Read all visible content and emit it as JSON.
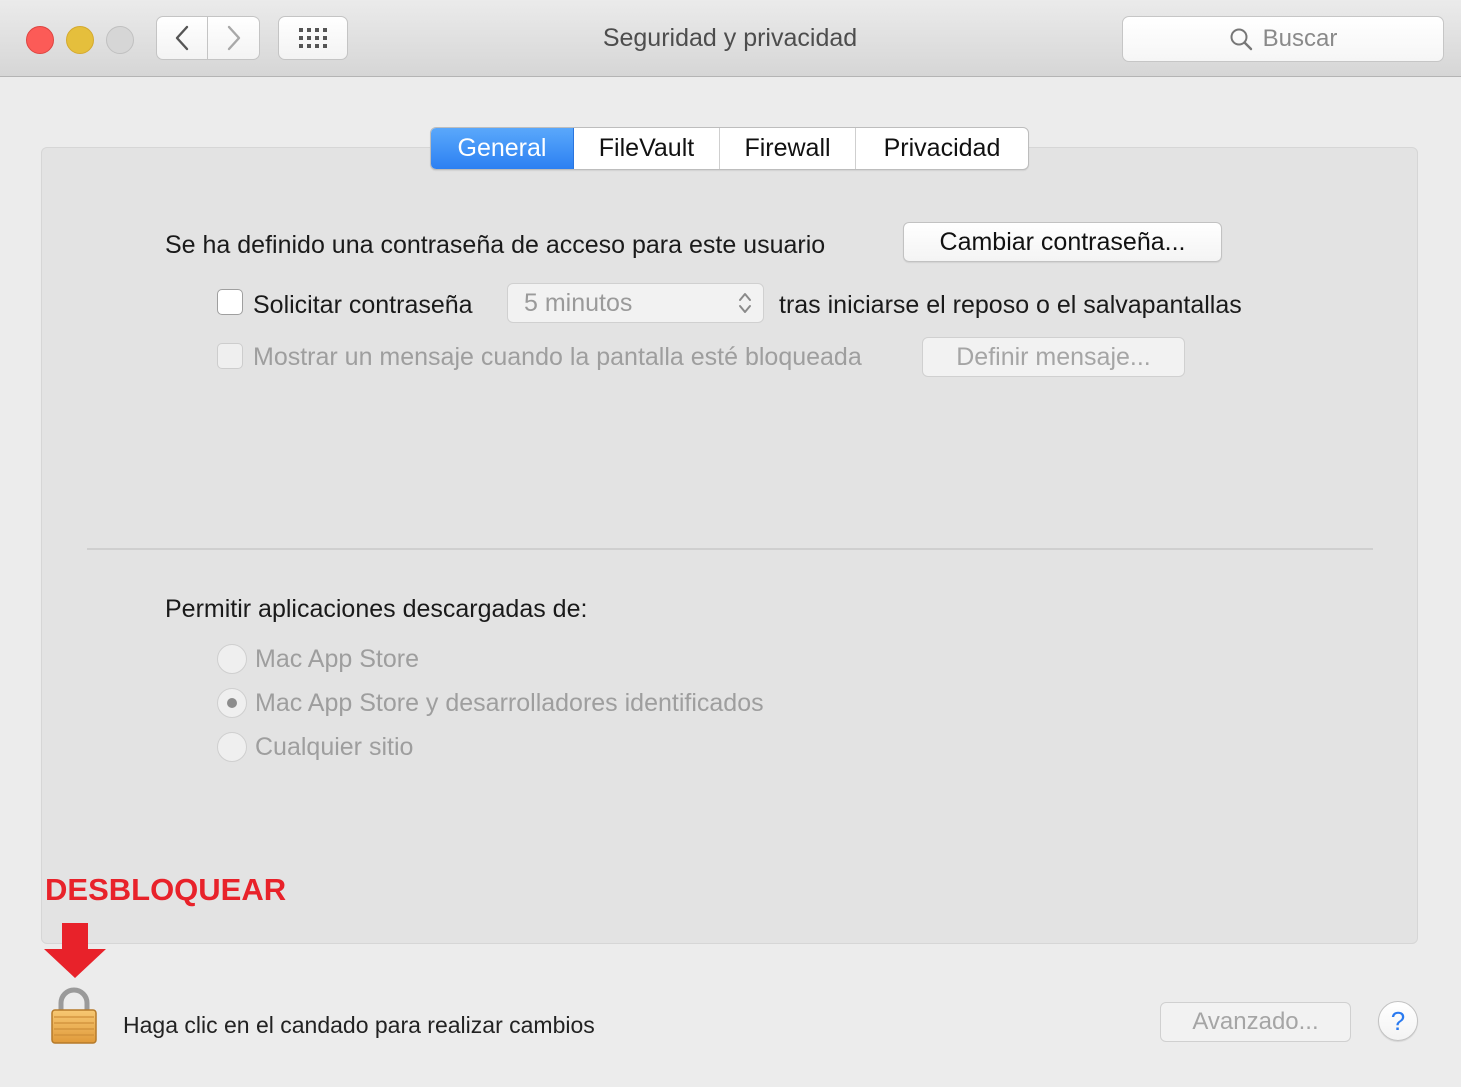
{
  "window": {
    "title": "Seguridad y privacidad",
    "search_placeholder": "Buscar",
    "icons": {
      "close": "close-traffic-light",
      "minimize": "minimize-traffic-light",
      "zoom": "zoom-traffic-light",
      "back": "chevron-left-icon",
      "forward": "chevron-right-icon",
      "grid": "grid-icon",
      "search": "search-icon"
    }
  },
  "tabs": [
    {
      "label": "General",
      "active": true
    },
    {
      "label": "FileVault",
      "active": false
    },
    {
      "label": "Firewall",
      "active": false
    },
    {
      "label": "Privacidad",
      "active": false
    }
  ],
  "general": {
    "password_set_text": "Se ha definido una contraseña de acceso para este usuario",
    "change_password_button": "Cambiar contraseña...",
    "require_password": {
      "label": "Solicitar contraseña",
      "checked": false,
      "delay_value": "5 minutos",
      "suffix": "tras iniciarse el reposo o el salvapantallas"
    },
    "show_message": {
      "label": "Mostrar un mensaje cuando la pantalla esté bloqueada",
      "checked": false,
      "enabled": false,
      "button": "Definir mensaje..."
    },
    "allow_apps": {
      "heading": "Permitir aplicaciones descargadas de:",
      "options": [
        {
          "label": "Mac App Store",
          "selected": false
        },
        {
          "label": "Mac App Store y desarrolladores identificados",
          "selected": true
        },
        {
          "label": "Cualquier sitio",
          "selected": false
        }
      ]
    }
  },
  "annotation": {
    "label": "DESBLOQUEAR",
    "color": "#e8222a",
    "icon": "arrow-down-icon"
  },
  "footer": {
    "lock_icon": "lock-icon",
    "lock_text": "Haga clic en el candado para realizar cambios",
    "advanced_button": "Avanzado...",
    "help_label": "?"
  },
  "colors": {
    "accent": "#2c80f2",
    "panel_bg": "#e3e3e3",
    "window_bg": "#ececec"
  }
}
